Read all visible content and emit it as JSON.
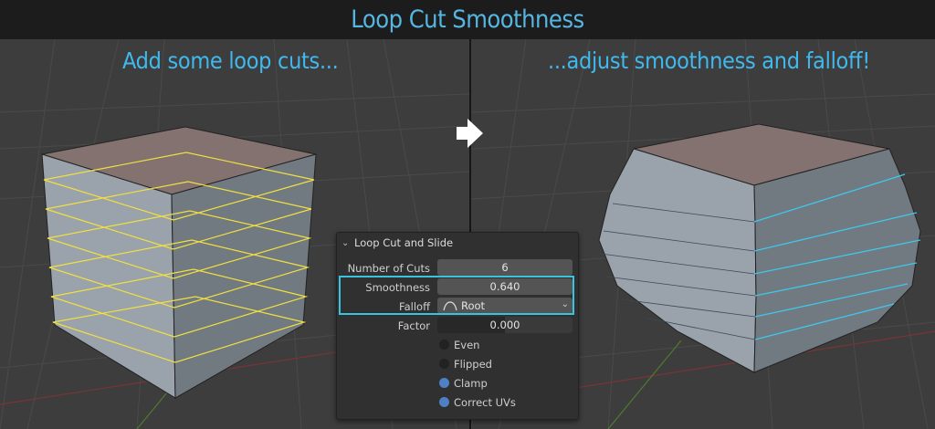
{
  "title": "Loop Cut Smoothness",
  "captions": {
    "left": "Add some loop cuts...",
    "right": "...adjust smoothness and falloff!"
  },
  "icons": {
    "arrow": "arrow-right-icon",
    "collapse": "chevron-down-icon",
    "falloff": "root-falloff-curve-icon",
    "dropdown": "dropdown-chevron-icon"
  },
  "colors": {
    "title": "#56b6e2",
    "caption": "#3fb9ee",
    "loop_cut_left": "#f0e040",
    "loop_cut_right": "#3ec8ea",
    "highlight": "#39c3dc",
    "checkbox_on": "#4e80c6"
  },
  "operator_panel": {
    "title": "Loop Cut and Slide",
    "fields": {
      "number_of_cuts": {
        "label": "Number of Cuts",
        "value": "6"
      },
      "smoothness": {
        "label": "Smoothness",
        "value": "0.640"
      },
      "falloff": {
        "label": "Falloff",
        "value": "Root"
      },
      "factor": {
        "label": "Factor",
        "value": "0.000"
      }
    },
    "checkboxes": [
      {
        "label": "Even",
        "checked": false
      },
      {
        "label": "Flipped",
        "checked": false
      },
      {
        "label": "Clamp",
        "checked": true
      },
      {
        "label": "Correct UVs",
        "checked": true
      }
    ]
  }
}
